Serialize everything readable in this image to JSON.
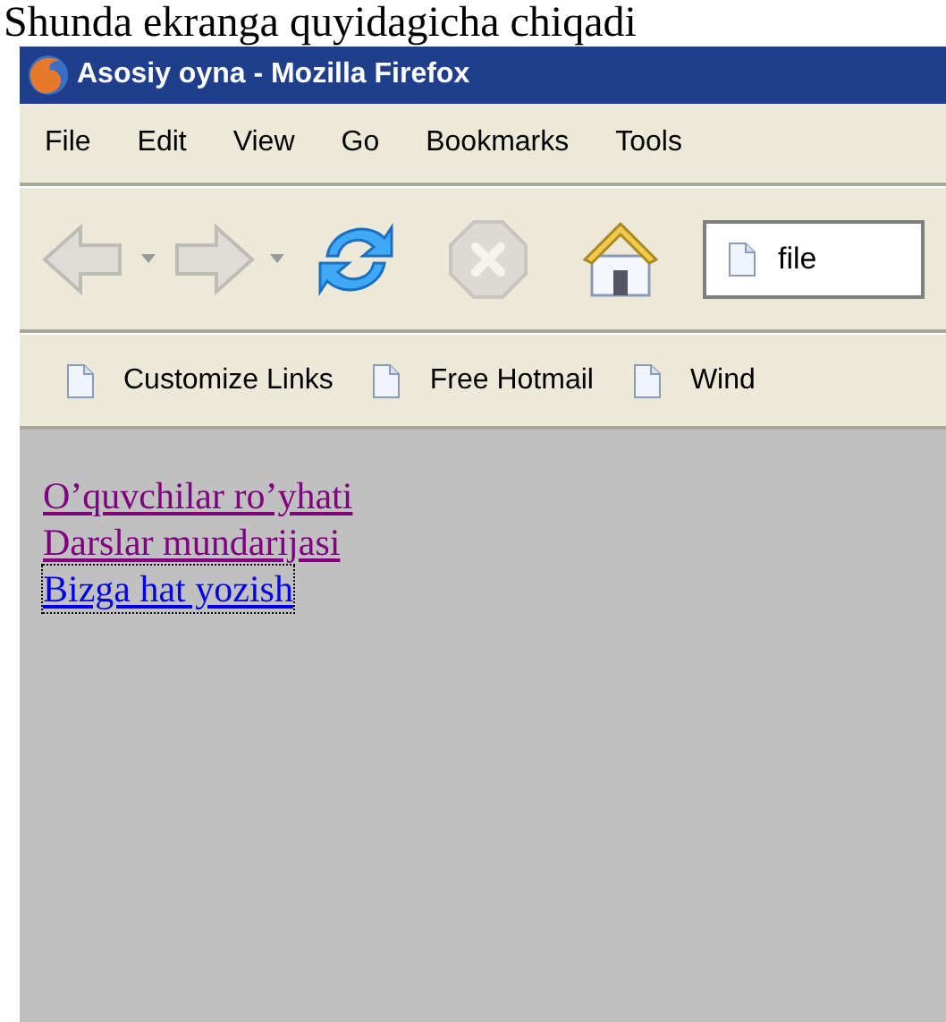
{
  "caption": "Shunda ekranga quyidagicha chiqadi",
  "window": {
    "title": "Asosiy oyna - Mozilla Firefox"
  },
  "menu": [
    "File",
    "Edit",
    "View",
    "Go",
    "Bookmarks",
    "Tools"
  ],
  "toolbar": {
    "buttons": [
      {
        "kind": "back",
        "disabled": true
      },
      {
        "kind": "forward",
        "disabled": true
      },
      {
        "kind": "reload",
        "disabled": false
      },
      {
        "kind": "stop",
        "disabled": true
      },
      {
        "kind": "home",
        "disabled": false
      }
    ],
    "address": {
      "value": "file"
    }
  },
  "bookmarks": [
    "Customize Links",
    "Free Hotmail",
    "Wind"
  ],
  "links": [
    {
      "label": "O’quvchilar ro’yhati",
      "visited": true,
      "focused": false
    },
    {
      "label": "Darslar mundarijasi",
      "visited": true,
      "focused": false
    },
    {
      "label": "Bizga hat yozish",
      "visited": false,
      "focused": true
    }
  ]
}
